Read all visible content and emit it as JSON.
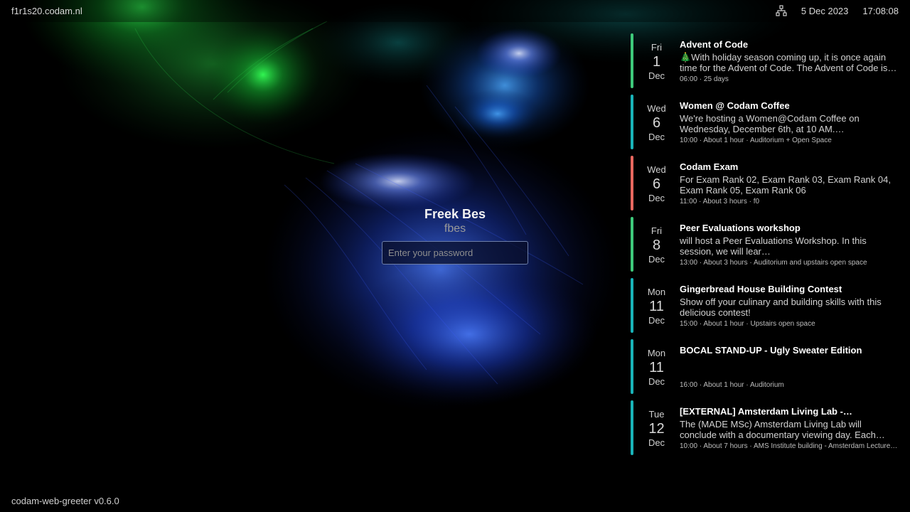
{
  "topbar": {
    "hostname": "f1r1s20.codam.nl",
    "network_icon": "network-icon",
    "date": "5 Dec 2023",
    "time": "17:08:08"
  },
  "login": {
    "display_name": "Freek Bes",
    "username": "fbes",
    "password_placeholder": "Enter your password"
  },
  "events": [
    {
      "dow": "Fri",
      "day": "1",
      "month": "Dec",
      "title": "Advent of Code",
      "description": "🎄With holiday season coming up, it is once again time for the Advent of Code. The Advent of Code is…",
      "meta": "06:00 · 25 days",
      "color": "#3ec97a"
    },
    {
      "dow": "Wed",
      "day": "6",
      "month": "Dec",
      "title": "Women @ Codam Coffee",
      "description": "We're hosting a Women@Codam Coffee on Wednesday, December 6th, at 10 AM.…",
      "meta": "10:00 · About 1 hour · Auditorium + Open Space",
      "color": "#19b3b8"
    },
    {
      "dow": "Wed",
      "day": "6",
      "month": "Dec",
      "title": "Codam Exam",
      "description": "For Exam Rank 02, Exam Rank 03, Exam Rank 04, Exam Rank 05, Exam Rank 06",
      "meta": "11:00 · About 3 hours · f0",
      "color": "#e8685f"
    },
    {
      "dow": "Fri",
      "day": "8",
      "month": "Dec",
      "title": "Peer Evaluations workshop",
      "description": "will host a Peer Evaluations Workshop. In this session, we will lear…",
      "meta": "13:00 · About 3 hours · Auditorium and upstairs open space",
      "color": "#3ec97a"
    },
    {
      "dow": "Mon",
      "day": "11",
      "month": "Dec",
      "title": "Gingerbread House Building Contest",
      "description": "Show off your culinary and building skills with this delicious contest!",
      "meta": "15:00 · About 1 hour · Upstairs open space",
      "color": "#19b3b8"
    },
    {
      "dow": "Mon",
      "day": "11",
      "month": "Dec",
      "title": "BOCAL STAND-UP - Ugly Sweater Edition",
      "description": "",
      "meta": "16:00 · About 1 hour · Auditorium",
      "color": "#19b3b8"
    },
    {
      "dow": "Tue",
      "day": "12",
      "month": "Dec",
      "title": "[EXTERNAL] Amsterdam Living Lab -…",
      "description": "The (MADE MSc) Amsterdam Living Lab will conclude with a documentary viewing day. Each…",
      "meta": "10:00 · About 7 hours · AMS Institute building - Amsterdam Lecture…",
      "color": "#19b3b8"
    }
  ],
  "footer": {
    "version": "codam-web-greeter v0.6.0"
  }
}
